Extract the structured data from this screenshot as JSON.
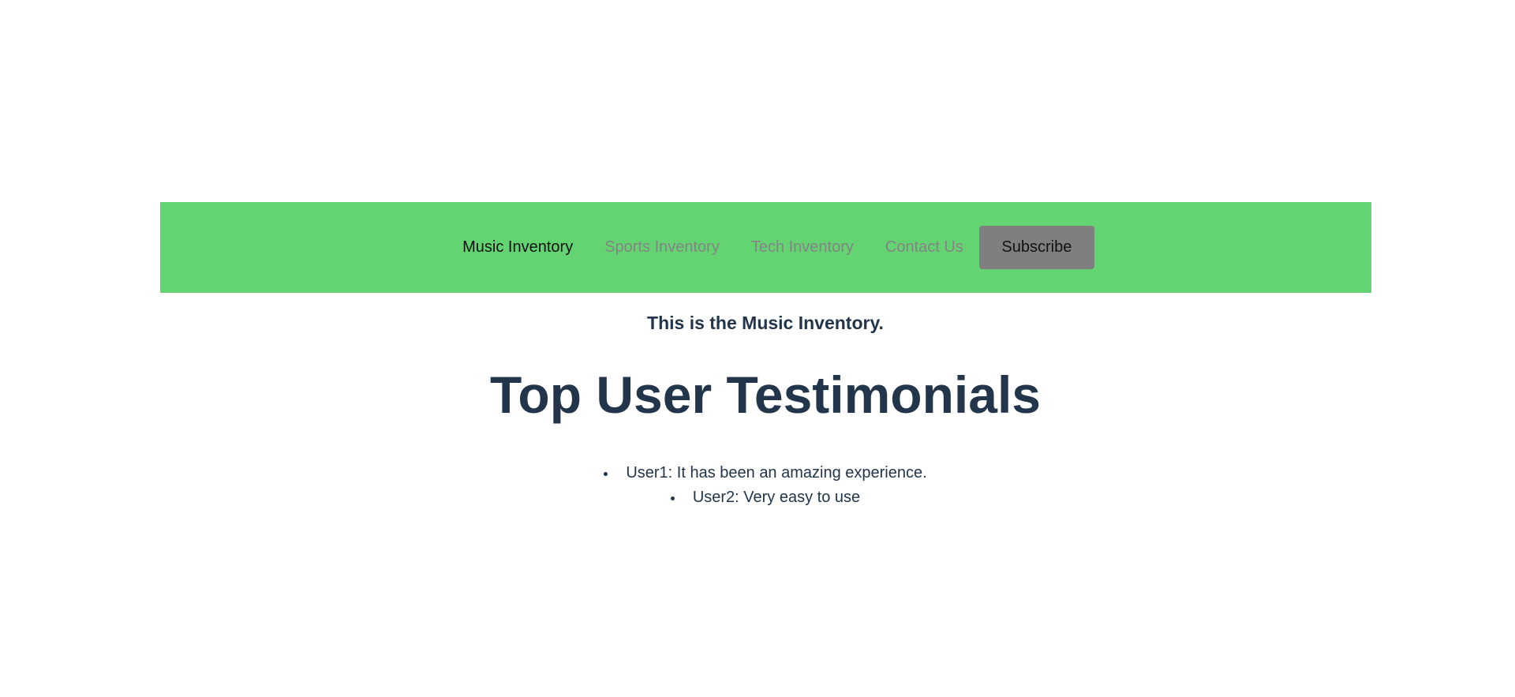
{
  "nav": {
    "links": [
      {
        "label": "Music Inventory",
        "active": true
      },
      {
        "label": "Sports Inventory",
        "active": false
      },
      {
        "label": "Tech Inventory",
        "active": false
      },
      {
        "label": "Contact Us",
        "active": false
      }
    ],
    "subscribe_label": "Subscribe"
  },
  "main": {
    "intro": "This is the Music Inventory.",
    "heading": "Top User Testimonials",
    "testimonials": [
      "User1: It has been an amazing experience.",
      "User2: Very easy to use"
    ]
  },
  "colors": {
    "navbar_bg": "#64d473",
    "subscribe_bg": "#7f7f7f",
    "text_primary": "#22354a",
    "link_inactive": "#848484",
    "link_active": "#111111"
  }
}
